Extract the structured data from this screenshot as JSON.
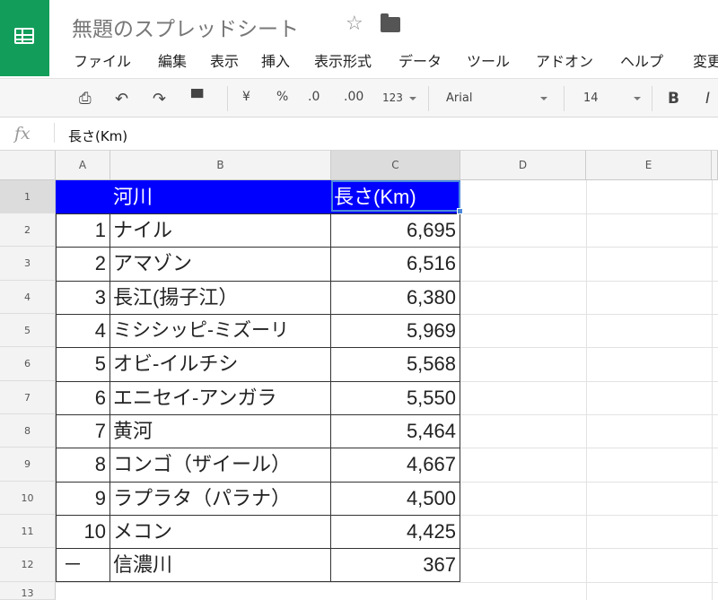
{
  "app": {
    "title": "無題のスプレッドシート",
    "star_icon": "star-icon",
    "folder_icon": "folder-icon"
  },
  "menu": [
    "ファイル",
    "編集",
    "表示",
    "挿入",
    "表示形式",
    "データ",
    "ツール",
    "アドオン",
    "ヘルプ",
    "変更"
  ],
  "toolbar": {
    "currency": "¥",
    "percent": "%",
    "dec_decrease": ".0",
    "dec_increase": ".00",
    "number_format": "123",
    "font": "Arial",
    "font_size": "14",
    "bold": "B",
    "italic": "I"
  },
  "formula_bar": {
    "fx": "fx",
    "value": "長さ(Km)"
  },
  "columns": [
    "A",
    "B",
    "C",
    "D",
    "E"
  ],
  "rows": [
    "1",
    "2",
    "3",
    "4",
    "5",
    "6",
    "7",
    "8",
    "9",
    "10",
    "11",
    "12",
    "13"
  ],
  "table": {
    "header": {
      "a": "",
      "b": "河川",
      "c": "長さ(Km)"
    },
    "rows": [
      {
        "a": "1",
        "b": "ナイル",
        "c": "6,695"
      },
      {
        "a": "2",
        "b": "アマゾン",
        "c": "6,516"
      },
      {
        "a": "3",
        "b": "長江(揚子江）",
        "c": "6,380"
      },
      {
        "a": "4",
        "b": "ミシシッピ-ミズーリ",
        "c": "5,969"
      },
      {
        "a": "5",
        "b": "オビ-イルチシ",
        "c": "5,568"
      },
      {
        "a": "6",
        "b": "エニセイ-アンガラ",
        "c": "5,550"
      },
      {
        "a": "7",
        "b": "黄河",
        "c": "5,464"
      },
      {
        "a": "8",
        "b": "コンゴ（ザイール）",
        "c": "4,667"
      },
      {
        "a": "9",
        "b": "ラプラタ（パラナ）",
        "c": "4,500"
      },
      {
        "a": "10",
        "b": "メコン",
        "c": "4,425"
      },
      {
        "a": "－",
        "b": "信濃川",
        "c": "367"
      }
    ]
  },
  "colors": {
    "header_fill": "#0000ff",
    "header_text": "#ffffff",
    "logo": "#129d5a",
    "selection": "#4a89dc"
  }
}
